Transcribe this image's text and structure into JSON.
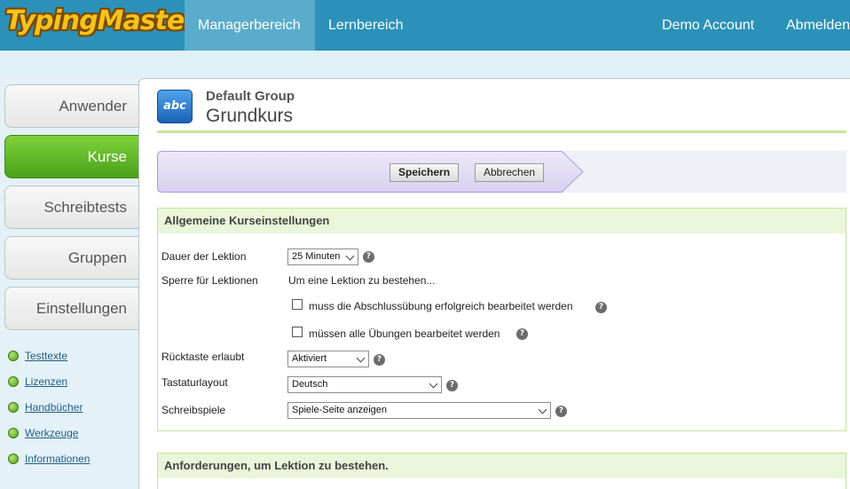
{
  "app": {
    "logo_text": "TypingMaster"
  },
  "nav": {
    "manager": "Managerbereich",
    "learning": "Lernbereich",
    "account": "Demo Account",
    "logout": "Abmelden"
  },
  "sidebar": {
    "menu": [
      "Anwender",
      "Kurse",
      "Schreibtests",
      "Gruppen",
      "Einstellungen"
    ],
    "links": [
      "Testtexte",
      "Lizenzen",
      "Handbücher",
      "Werkzeuge",
      "Informationen"
    ]
  },
  "header": {
    "icon_text": "abc",
    "group": "Default Group",
    "course": "Grundkurs"
  },
  "toolbar": {
    "save": "Speichern",
    "cancel": "Abbrechen"
  },
  "general": {
    "title": "Allgemeine Kurseinstellungen",
    "duration_label": "Dauer der Lektion",
    "duration_value": "25 Minuten",
    "lock_label": "Sperre für Lektionen",
    "lock_text": "Um eine Lektion zu bestehen...",
    "lock_option_1": "muss die Abschlussübung erfolgreich bearbeitet werden",
    "lock_option_2": "müssen alle Übungen bearbeitet werden",
    "backspace_label": "Rücktaste erlaubt",
    "backspace_value": "Aktiviert",
    "layout_label": "Tastaturlayout",
    "layout_value": "Deutsch",
    "games_label": "Schreibspiele",
    "games_value": "Spiele-Seite anzeigen",
    "help_glyph": "?"
  },
  "requirements": {
    "title": "Anforderungen, um Lektion zu bestehen."
  },
  "colors": {
    "topbar": "#2b91b8",
    "active_nav": "#5aaccc",
    "active_menu": "#4aa11b",
    "section_border": "#c6e59a",
    "section_head": "#eaf6d9"
  }
}
